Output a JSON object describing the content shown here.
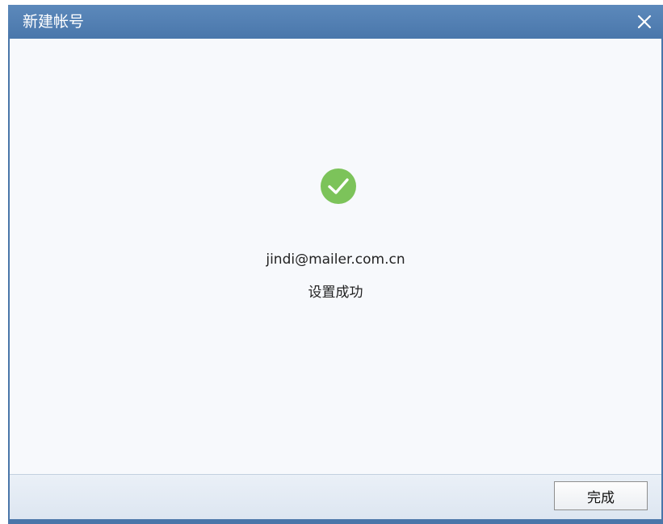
{
  "window": {
    "title": "新建帐号"
  },
  "content": {
    "email": "jindi@mailer.com.cn",
    "status_text": "设置成功",
    "icon": "check-circle-icon"
  },
  "footer": {
    "finish_label": "完成"
  },
  "colors": {
    "titlebar": "#4a77ab",
    "success_green": "#7cc35a",
    "content_bg": "#f7f9fc"
  }
}
